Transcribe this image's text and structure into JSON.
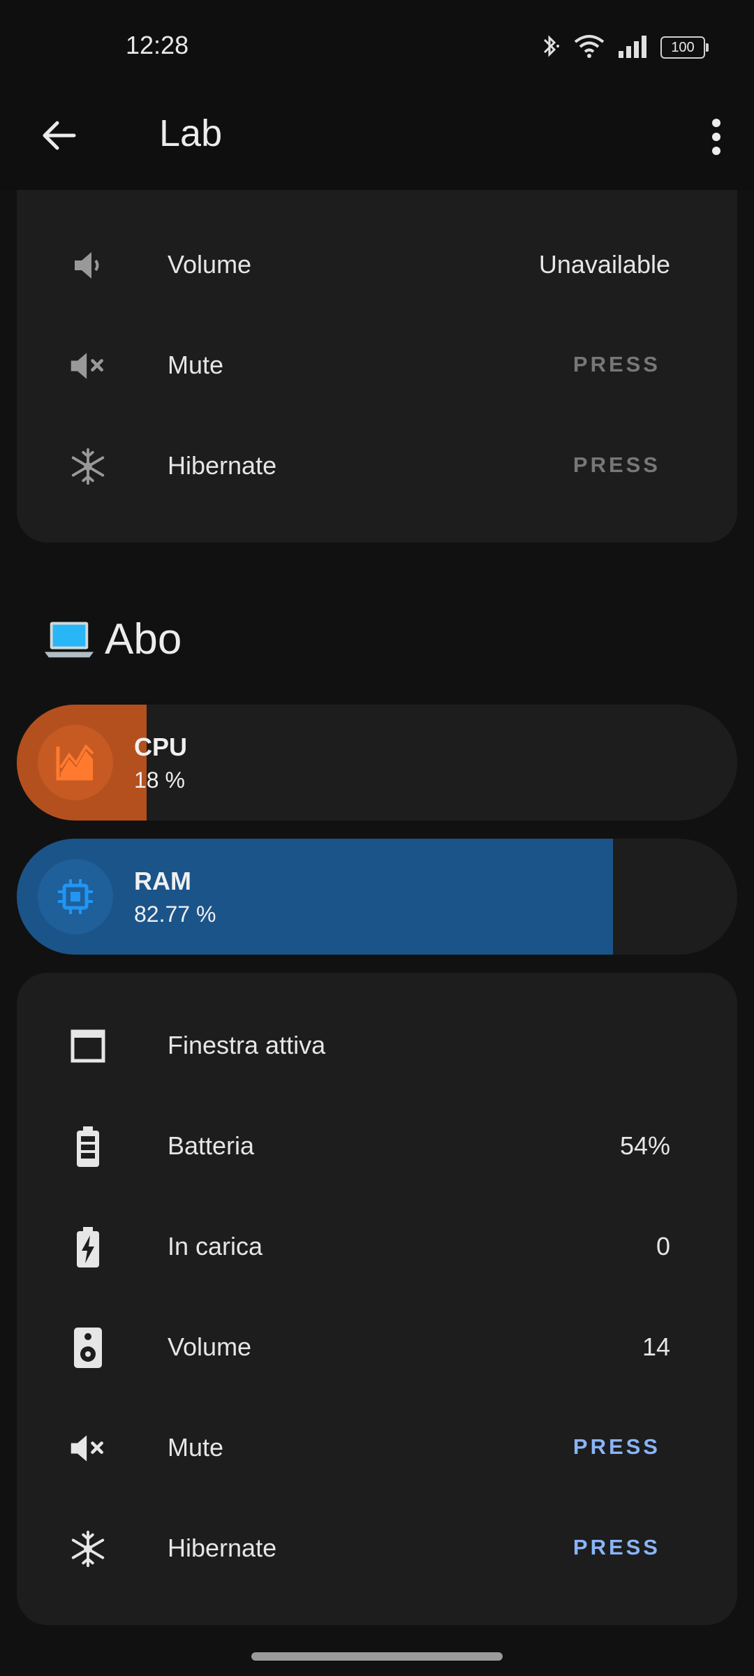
{
  "status_bar": {
    "time": "12:28",
    "battery": "100"
  },
  "app_bar": {
    "title": "Lab"
  },
  "top_card": {
    "rows": [
      {
        "label": "Volume",
        "value": "Unavailable"
      },
      {
        "label": "Mute",
        "action": "PRESS"
      },
      {
        "label": "Hibernate",
        "action": "PRESS"
      }
    ]
  },
  "section": {
    "emoji": "laptop",
    "title": "Abo"
  },
  "meters": [
    {
      "name": "CPU",
      "value": "18 %",
      "fraction": 0.18,
      "color": "#b4501e",
      "icon": "chart-line-icon"
    },
    {
      "name": "RAM",
      "value": "82.77 %",
      "fraction": 0.8277,
      "color": "#1b5489",
      "icon": "memory-chip-icon"
    }
  ],
  "bottom_card": {
    "rows": [
      {
        "label": "Finestra attiva",
        "value": "",
        "icon": "window-icon"
      },
      {
        "label": "Batteria",
        "value": "54%",
        "icon": "battery-icon"
      },
      {
        "label": "In carica",
        "value": "0",
        "icon": "battery-charging-icon"
      },
      {
        "label": "Volume",
        "value": "14",
        "icon": "speaker-icon"
      },
      {
        "label": "Mute",
        "action": "PRESS",
        "icon": "volume-mute-icon"
      },
      {
        "label": "Hibernate",
        "action": "PRESS",
        "icon": "snowflake-icon"
      }
    ]
  }
}
